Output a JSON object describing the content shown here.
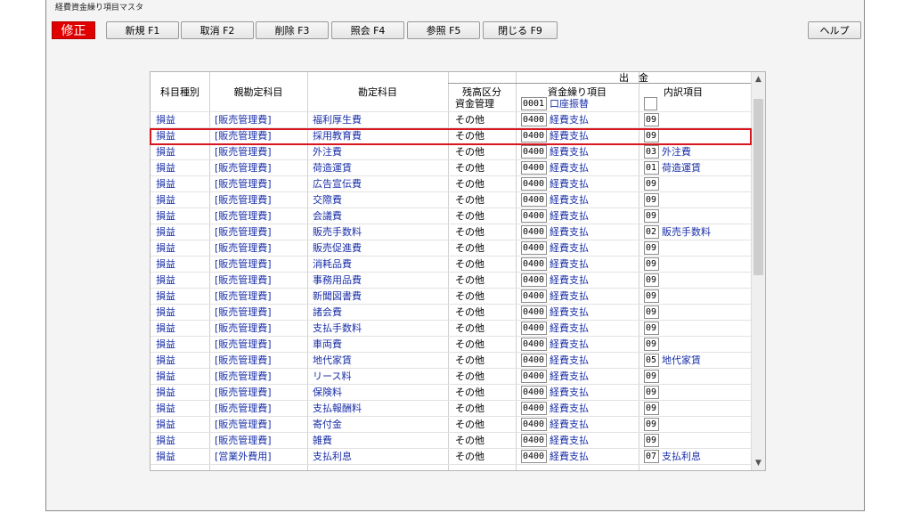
{
  "window": {
    "title": "経費資金繰り項目マスタ"
  },
  "mode": {
    "label": "修正",
    "color": "#e00000"
  },
  "toolbar": {
    "new_label": "新規 F1",
    "cancel_label": "取消 F2",
    "delete_label": "削除 F3",
    "inquiry_label": "照会 F4",
    "reference_label": "参照 F5",
    "close_label": "閉じる F9",
    "help_label": "ヘルプ"
  },
  "table": {
    "group_header": "出　金",
    "headers": {
      "category": "科目種別",
      "parent": "親勘定科目",
      "account": "勘定科目",
      "balance": "残高区分",
      "cashflow": "資金繰り項目",
      "detail": "内訳項目"
    },
    "fund_row": {
      "balance": "資金管理",
      "cf_code": "0001",
      "cf_name": "口座振替"
    },
    "rows": [
      {
        "category": "損益",
        "parent": "[販売管理費]",
        "account": "福利厚生費",
        "balance": "その他",
        "cf_code": "0400",
        "cf_name": "経費支払",
        "detail_code": "09",
        "detail_name": ""
      },
      {
        "category": "損益",
        "parent": "[販売管理費]",
        "account": "採用教育費",
        "balance": "その他",
        "cf_code": "0400",
        "cf_name": "経費支払",
        "detail_code": "09",
        "detail_name": ""
      },
      {
        "category": "損益",
        "parent": "[販売管理費]",
        "account": "外注費",
        "balance": "その他",
        "cf_code": "0400",
        "cf_name": "経費支払",
        "detail_code": "03",
        "detail_name": "外注費"
      },
      {
        "category": "損益",
        "parent": "[販売管理費]",
        "account": "荷造運賃",
        "balance": "その他",
        "cf_code": "0400",
        "cf_name": "経費支払",
        "detail_code": "01",
        "detail_name": "荷造運賃"
      },
      {
        "category": "損益",
        "parent": "[販売管理費]",
        "account": "広告宣伝費",
        "balance": "その他",
        "cf_code": "0400",
        "cf_name": "経費支払",
        "detail_code": "09",
        "detail_name": ""
      },
      {
        "category": "損益",
        "parent": "[販売管理費]",
        "account": "交際費",
        "balance": "その他",
        "cf_code": "0400",
        "cf_name": "経費支払",
        "detail_code": "09",
        "detail_name": ""
      },
      {
        "category": "損益",
        "parent": "[販売管理費]",
        "account": "会議費",
        "balance": "その他",
        "cf_code": "0400",
        "cf_name": "経費支払",
        "detail_code": "09",
        "detail_name": ""
      },
      {
        "category": "損益",
        "parent": "[販売管理費]",
        "account": "販売手数料",
        "balance": "その他",
        "cf_code": "0400",
        "cf_name": "経費支払",
        "detail_code": "02",
        "detail_name": "販売手数料"
      },
      {
        "category": "損益",
        "parent": "[販売管理費]",
        "account": "販売促進費",
        "balance": "その他",
        "cf_code": "0400",
        "cf_name": "経費支払",
        "detail_code": "09",
        "detail_name": ""
      },
      {
        "category": "損益",
        "parent": "[販売管理費]",
        "account": "消耗品費",
        "balance": "その他",
        "cf_code": "0400",
        "cf_name": "経費支払",
        "detail_code": "09",
        "detail_name": ""
      },
      {
        "category": "損益",
        "parent": "[販売管理費]",
        "account": "事務用品費",
        "balance": "その他",
        "cf_code": "0400",
        "cf_name": "経費支払",
        "detail_code": "09",
        "detail_name": ""
      },
      {
        "category": "損益",
        "parent": "[販売管理費]",
        "account": "新聞図書費",
        "balance": "その他",
        "cf_code": "0400",
        "cf_name": "経費支払",
        "detail_code": "09",
        "detail_name": ""
      },
      {
        "category": "損益",
        "parent": "[販売管理費]",
        "account": "諸会費",
        "balance": "その他",
        "cf_code": "0400",
        "cf_name": "経費支払",
        "detail_code": "09",
        "detail_name": ""
      },
      {
        "category": "損益",
        "parent": "[販売管理費]",
        "account": "支払手数料",
        "balance": "その他",
        "cf_code": "0400",
        "cf_name": "経費支払",
        "detail_code": "09",
        "detail_name": ""
      },
      {
        "category": "損益",
        "parent": "[販売管理費]",
        "account": "車両費",
        "balance": "その他",
        "cf_code": "0400",
        "cf_name": "経費支払",
        "detail_code": "09",
        "detail_name": ""
      },
      {
        "category": "損益",
        "parent": "[販売管理費]",
        "account": "地代家賃",
        "balance": "その他",
        "cf_code": "0400",
        "cf_name": "経費支払",
        "detail_code": "05",
        "detail_name": "地代家賃"
      },
      {
        "category": "損益",
        "parent": "[販売管理費]",
        "account": "リース料",
        "balance": "その他",
        "cf_code": "0400",
        "cf_name": "経費支払",
        "detail_code": "09",
        "detail_name": ""
      },
      {
        "category": "損益",
        "parent": "[販売管理費]",
        "account": "保険料",
        "balance": "その他",
        "cf_code": "0400",
        "cf_name": "経費支払",
        "detail_code": "09",
        "detail_name": ""
      },
      {
        "category": "損益",
        "parent": "[販売管理費]",
        "account": "支払報酬料",
        "balance": "その他",
        "cf_code": "0400",
        "cf_name": "経費支払",
        "detail_code": "09",
        "detail_name": ""
      },
      {
        "category": "損益",
        "parent": "[販売管理費]",
        "account": "寄付金",
        "balance": "その他",
        "cf_code": "0400",
        "cf_name": "経費支払",
        "detail_code": "09",
        "detail_name": ""
      },
      {
        "category": "損益",
        "parent": "[販売管理費]",
        "account": "雑費",
        "balance": "その他",
        "cf_code": "0400",
        "cf_name": "経費支払",
        "detail_code": "09",
        "detail_name": ""
      },
      {
        "category": "損益",
        "parent": "[営業外費用]",
        "account": "支払利息",
        "balance": "その他",
        "cf_code": "0400",
        "cf_name": "経費支払",
        "detail_code": "07",
        "detail_name": "支払利息"
      }
    ]
  },
  "colors": {
    "link": "#1a2fa8",
    "selection": "#d8161e"
  },
  "icons": {
    "scroll_up": "chevron-up-icon",
    "scroll_down": "chevron-down-icon"
  }
}
